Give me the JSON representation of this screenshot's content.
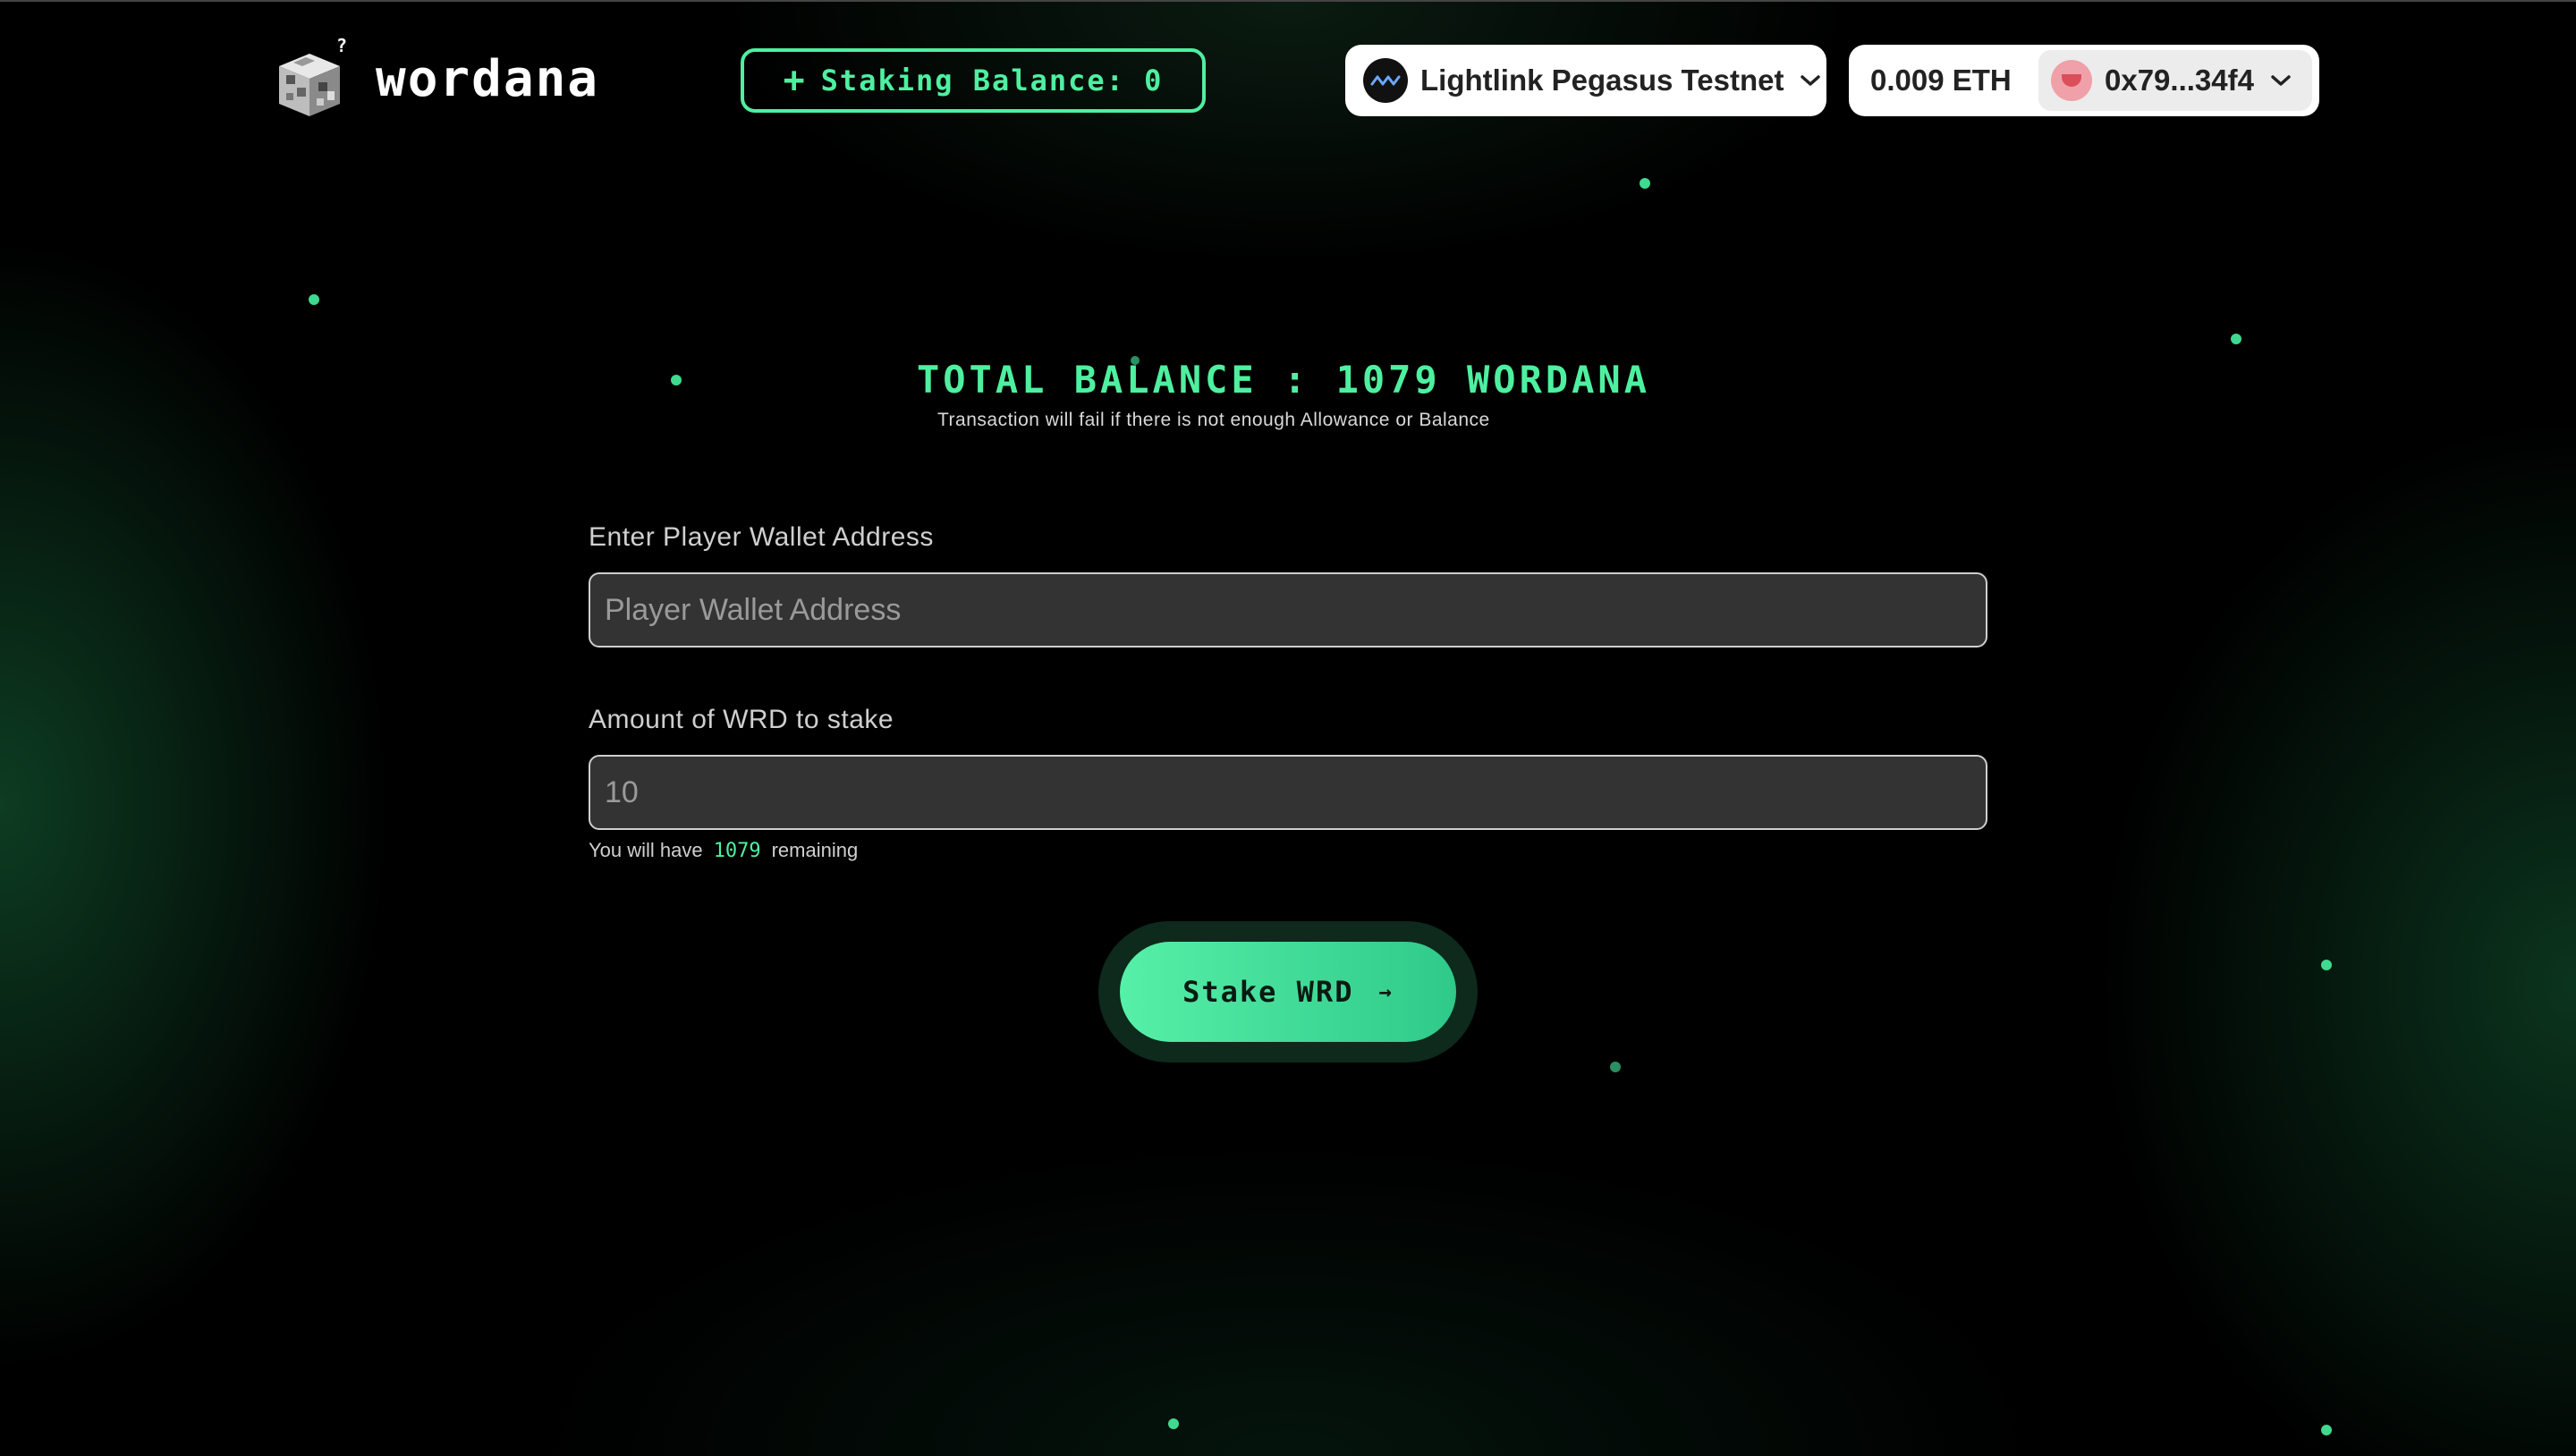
{
  "app": {
    "logo_text": "wordana"
  },
  "header": {
    "staking_balance_label": "Staking Balance: 0",
    "network_name": "Lightlink Pegasus Testnet",
    "eth_balance": "0.009 ETH",
    "account_address": "0x79...34f4"
  },
  "main": {
    "total_balance": "TOTAL BALANCE : 1079 WORDANA",
    "warning": "Transaction will fail if there is not enough Allowance or Balance",
    "wallet_label": "Enter Player Wallet Address",
    "wallet_placeholder": "Player Wallet Address",
    "amount_label": "Amount of WRD to stake",
    "amount_placeholder": "10",
    "remaining_prefix": "You will have",
    "remaining_value": "1079",
    "remaining_suffix": "remaining",
    "stake_button": "Stake WRD"
  },
  "colors": {
    "accent": "#4ef0a0",
    "background": "#000000"
  },
  "icons": {
    "logo": "pixel-cube-icon",
    "staking": "plus-icon",
    "network": "lightlink-icon",
    "dropdown": "chevron-down-icon",
    "avatar": "avatar-icon",
    "stake": "arrow-right-icon"
  }
}
